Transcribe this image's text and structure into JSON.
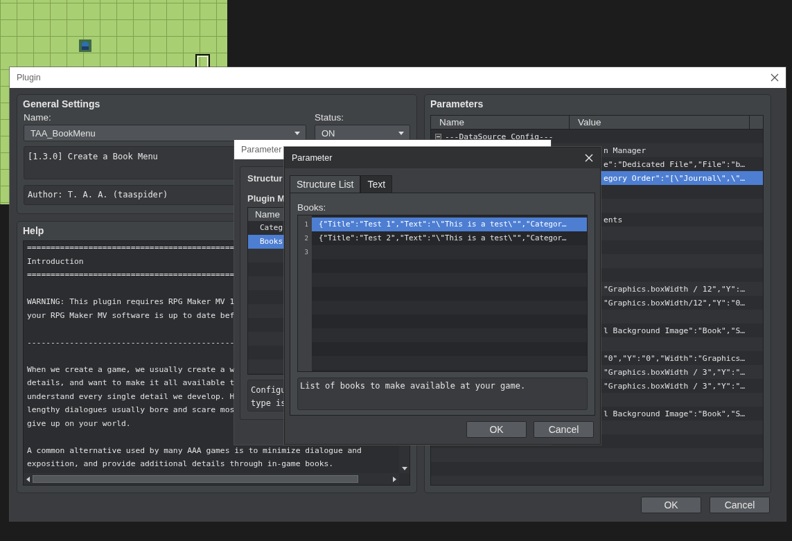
{
  "plugin_window": {
    "title": "Plugin",
    "general_settings": {
      "title": "General Settings",
      "name_label": "Name:",
      "name_value": "TAA_BookMenu",
      "status_label": "Status:",
      "status_value": "ON",
      "description": "[1.3.0] Create a Book Menu",
      "author": "Author: T. A. A. (taaspider)"
    },
    "help": {
      "title": "Help",
      "paragraphs": [
        [
          "============================================",
          "Introduction",
          "============================================"
        ],
        [
          "WARNING: This plugin requires RPG Maker MV 1",
          "your RPG Maker MV software is up to date bef"
        ],
        [
          "--------------------------------------------"
        ],
        [
          "When we create a game, we usually create a w",
          "details, and want to make it all available t",
          "understand every single detail we develop. H",
          "lengthy dialogues usually bore and scare mos",
          "give up on your world."
        ],
        [
          "A common alternative used by many AAA games is to minimize dialogue and",
          "exposition, and provide additional details through in-game books."
        ]
      ]
    },
    "parameters": {
      "title": "Parameters",
      "columns": [
        "Name",
        "Value"
      ],
      "rows": [
        {
          "kind": "group",
          "name": "---DataSource Config---",
          "expanded": true,
          "selected": false
        },
        {
          "kind": "param",
          "value": "n Manager",
          "selected": false
        },
        {
          "kind": "param",
          "value": "e\":\"Dedicated File\",\"File\":\"b…",
          "selected": false
        },
        {
          "kind": "param",
          "value": "egory Order\":\"[\\\"Journal\\\",\\\"…",
          "selected": true
        },
        {
          "kind": "param",
          "selected": false
        },
        {
          "kind": "param",
          "selected": false
        },
        {
          "kind": "param",
          "value": "ents",
          "selected": false
        },
        {
          "kind": "param",
          "selected": false
        },
        {
          "kind": "param",
          "selected": false
        },
        {
          "kind": "param",
          "selected": false
        },
        {
          "kind": "param",
          "selected": false
        },
        {
          "kind": "param",
          "value": "\"Graphics.boxWidth / 12\",\"Y\":…",
          "selected": false
        },
        {
          "kind": "param",
          "value": "\"Graphics.boxWidth/12\",\"Y\":\"0…",
          "selected": false
        },
        {
          "kind": "param",
          "selected": false
        },
        {
          "kind": "param",
          "value": "l Background Image\":\"Book\",\"S…",
          "selected": false
        },
        {
          "kind": "param",
          "selected": false
        },
        {
          "kind": "param",
          "value": "\"0\",\"Y\":\"0\",\"Width\":\"Graphics…",
          "selected": false
        },
        {
          "kind": "param",
          "value": "\"Graphics.boxWidth / 3\",\"Y\":\"…",
          "selected": false
        },
        {
          "kind": "param",
          "value": "\"Graphics.boxWidth / 3\",\"Y\":\"…",
          "selected": false
        },
        {
          "kind": "param",
          "selected": false
        },
        {
          "kind": "param",
          "value": "l Background Image\":\"Book\",\"S…",
          "selected": false
        },
        {
          "kind": "param",
          "selected": false
        },
        {
          "kind": "param",
          "selected": false
        },
        {
          "kind": "param",
          "selected": false
        },
        {
          "kind": "param",
          "selected": false
        },
        {
          "kind": "param",
          "selected": false
        }
      ]
    },
    "buttons": [
      "OK",
      "Cancel"
    ]
  },
  "parameter_dialog_back": {
    "title": "Parameter",
    "tab": "Structur",
    "list_label": "Plugin M",
    "column": "Name",
    "rows": [
      {
        "name": "Categ",
        "selected": false
      },
      {
        "name": "Books",
        "selected": true
      }
    ],
    "description_lines": [
      "Configu",
      "type is"
    ]
  },
  "parameter_dialog": {
    "title": "Parameter",
    "tabs": [
      {
        "label": "Structure List",
        "selected": true
      },
      {
        "label": "Text",
        "selected": false
      }
    ],
    "list_label": "Books:",
    "items": [
      {
        "number": "1",
        "text": "{\"Title\":\"Test 1\",\"Text\":\"\\\"This is a test\\\"\",\"Categor…",
        "selected": true
      },
      {
        "number": "2",
        "text": "{\"Title\":\"Test 2\",\"Text\":\"\\\"This is a test\\\"\",\"Categor…",
        "selected": false
      },
      {
        "number": "3",
        "selected": false
      }
    ],
    "description": "List of books to make available at your game.",
    "buttons": [
      "OK",
      "Cancel"
    ]
  }
}
